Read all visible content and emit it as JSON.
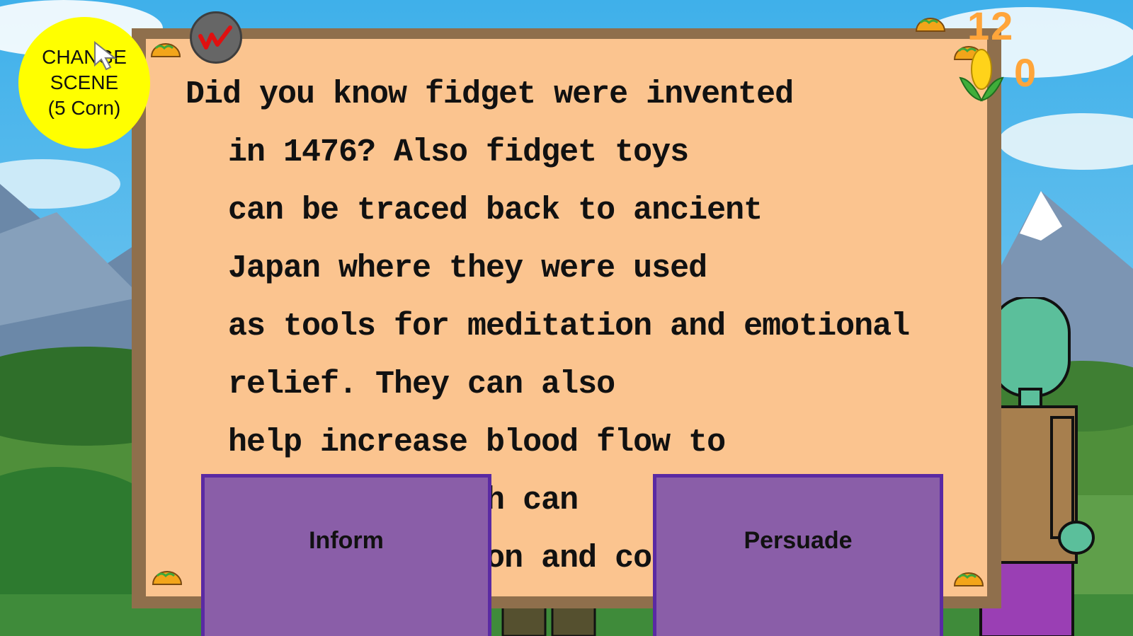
{
  "change_scene": {
    "line1": "CHANGE",
    "line2": "SCENE",
    "line3": "(5 Corn)"
  },
  "bell_icon": "red-squiggle-icon",
  "scores": {
    "top": "12",
    "corn": "0"
  },
  "board": {
    "lines": [
      "Did you know fidget were invented",
      "in 1476? Also fidget toys",
      "can be traced back to ancient",
      "Japan where they were used",
      "as tools for meditation and emotional",
      "relief. They can also",
      "help increase blood flow to",
      "the brain which can",
      "improve function and concentration."
    ]
  },
  "choices": {
    "inform": "Inform",
    "persuade": "Persuade"
  },
  "colors": {
    "board": "#fbc48f",
    "frame": "#8f6f4c",
    "button": "#8a5ea8",
    "button_border": "#5a2aa3",
    "score": "#ffa53a",
    "change_scene": "#ffff00"
  }
}
